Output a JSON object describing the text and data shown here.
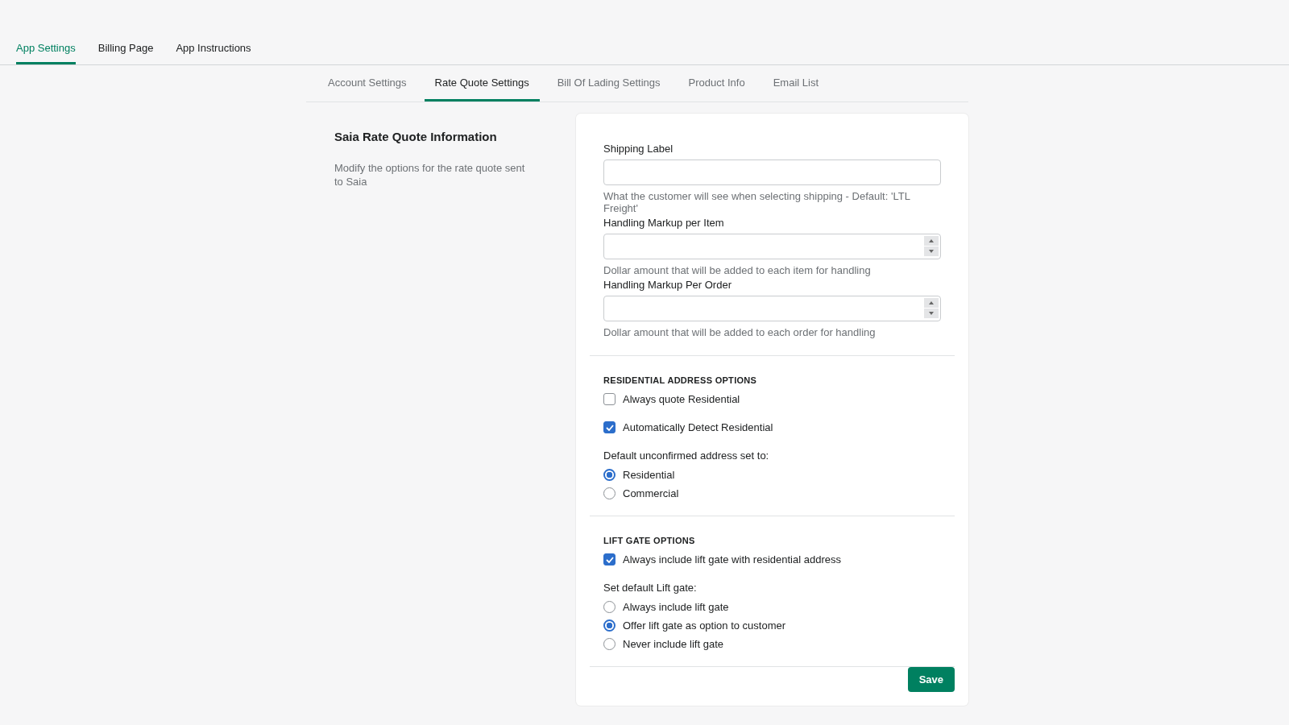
{
  "top_tabs": [
    {
      "label": "App Settings",
      "selected": true
    },
    {
      "label": "Billing Page",
      "selected": false
    },
    {
      "label": "App Instructions",
      "selected": false
    }
  ],
  "sub_tabs": [
    {
      "label": "Account Settings",
      "selected": false
    },
    {
      "label": "Rate Quote Settings",
      "selected": true
    },
    {
      "label": "Bill Of Lading Settings",
      "selected": false
    },
    {
      "label": "Product Info",
      "selected": false
    },
    {
      "label": "Email List",
      "selected": false
    }
  ],
  "info": {
    "title": "Saia Rate Quote Information",
    "description": "Modify the options for the rate quote sent to Saia"
  },
  "fields": [
    {
      "label": "Shipping Label",
      "kind": "text",
      "help": "What the customer will see when selecting shipping - Default: 'LTL Freight'"
    },
    {
      "label": "Handling Markup per Item",
      "kind": "number",
      "help": "Dollar amount that will be added to each item for handling"
    },
    {
      "label": "Handling Markup Per Order",
      "kind": "number",
      "help": "Dollar amount that will be added to each order for handling"
    }
  ],
  "sections": [
    {
      "heading": "RESIDENTIAL ADDRESS OPTIONS",
      "checkboxes": [
        {
          "label": "Always quote Residential",
          "checked": false
        },
        {
          "label": "Automatically Detect Residential",
          "checked": true
        }
      ],
      "radio_group": {
        "label": "Default unconfirmed address set to:",
        "options": [
          {
            "label": "Residential",
            "selected": true
          },
          {
            "label": "Commercial",
            "selected": false
          }
        ]
      }
    },
    {
      "heading": "LIFT GATE OPTIONS",
      "checkboxes": [
        {
          "label": "Always include lift gate with residential address",
          "checked": true
        }
      ],
      "radio_group": {
        "label": "Set default Lift gate:",
        "options": [
          {
            "label": "Always include lift gate",
            "selected": false
          },
          {
            "label": "Offer lift gate as option to customer",
            "selected": true
          },
          {
            "label": "Never include lift gate",
            "selected": false
          }
        ]
      }
    }
  ],
  "save_button": "Save"
}
